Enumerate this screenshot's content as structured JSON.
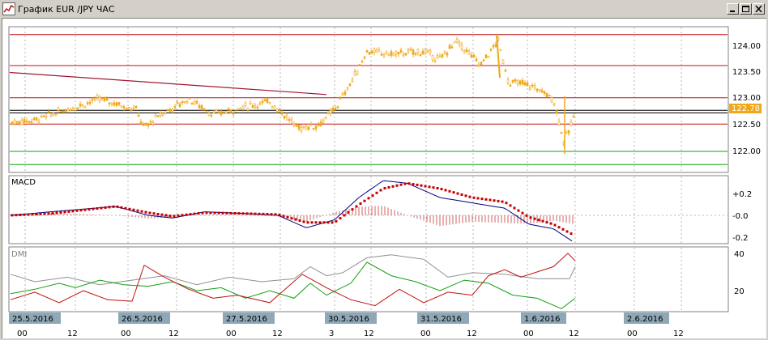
{
  "window": {
    "title": "График EUR /JPY  ЧАС"
  },
  "colors": {
    "candle": "#f0a818",
    "red_line": "#c01010",
    "green_line": "#10a010",
    "black_line": "#000000",
    "macd_line": "#000080",
    "signal_dots": "#c00000",
    "dmi_gray": "#909090",
    "price_tag_bg": "#f0a818",
    "date_tag_bg": "#8fa8b8",
    "grid": "#b8b8b8"
  },
  "main_panel": {
    "price_tag": "122.78",
    "y_labels": [
      "124.00",
      "123.50",
      "123.00",
      "122.50",
      "122.00"
    ]
  },
  "macd_panel": {
    "name": "MACD",
    "y_labels": [
      "+0.2",
      "-0.0",
      "-0.2"
    ]
  },
  "dmi_panel": {
    "name": "DMI",
    "y_labels": [
      "40",
      "20"
    ]
  },
  "time_axis": {
    "date_tags": [
      "25.5.2016",
      "26.5.2016",
      "27.5.2016",
      "30.5.2016",
      "31.5.2016",
      "1.6.2016",
      "2.6.2016"
    ],
    "hour_labels": [
      "00",
      "12",
      "00",
      "12",
      "00",
      "12",
      "3",
      "12",
      "00",
      "12",
      "00",
      "12",
      "00",
      "12"
    ]
  },
  "chart_data": {
    "type": "line",
    "ylim": [
      121.65,
      124.3
    ],
    "resistance_support_levels": [
      124.22,
      123.63,
      123.02,
      122.78,
      122.73,
      122.52,
      122.0,
      121.75
    ],
    "trendline": {
      "from_y": 123.5,
      "to_y": 123.08
    }
  }
}
